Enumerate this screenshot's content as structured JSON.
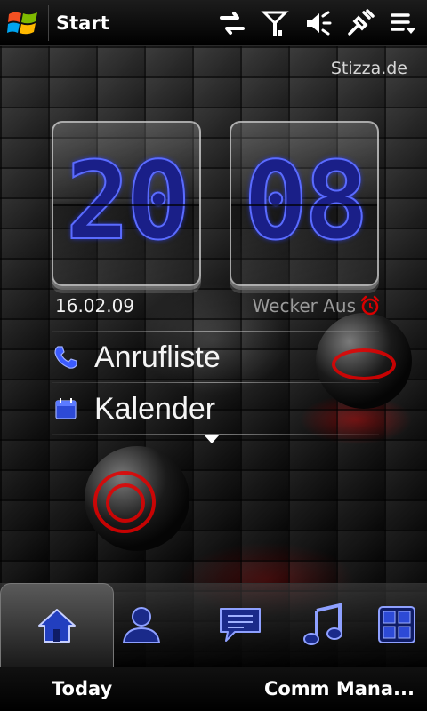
{
  "statusbar": {
    "title": "Start",
    "icons": [
      "windows-logo",
      "data-transfer-icon",
      "signal-icon",
      "speaker-icon",
      "power-plug-icon",
      "menu-icon"
    ]
  },
  "home": {
    "watermark": "Stizza.de",
    "clock": {
      "hours": "20",
      "minutes": "08"
    },
    "date": "16.02.09",
    "alarm_label": "Wecker Aus",
    "items": [
      {
        "label": "Anrufliste",
        "icon": "phone-icon"
      },
      {
        "label": "Kalender",
        "icon": "calendar-icon"
      }
    ]
  },
  "tabs": [
    {
      "name": "home",
      "icon": "home-icon",
      "selected": true
    },
    {
      "name": "people",
      "icon": "person-icon",
      "selected": false
    },
    {
      "name": "messages",
      "icon": "message-icon",
      "selected": false
    },
    {
      "name": "music",
      "icon": "music-note-icon",
      "selected": false
    },
    {
      "name": "programs",
      "icon": "apps-grid-icon",
      "selected": false
    }
  ],
  "softkeys": {
    "left": "Today",
    "right": "Comm Mana..."
  },
  "colors": {
    "accent_blue": "#3b5bff",
    "alarm_red": "#d80000",
    "bar_black": "#000000"
  }
}
